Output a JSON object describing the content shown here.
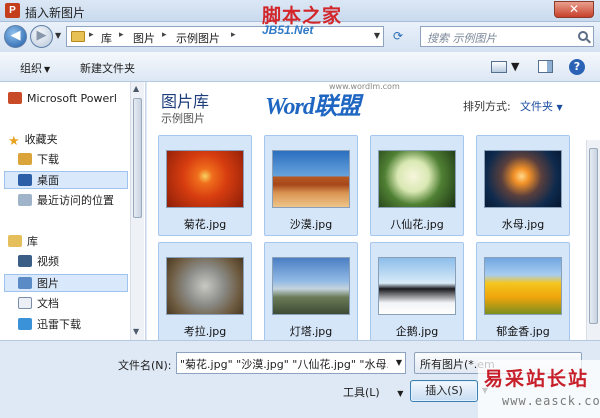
{
  "window": {
    "app_icon_letter": "P",
    "title": "插入新图片",
    "close_glyph": "✕"
  },
  "address": {
    "crumbs": [
      "库",
      "图片",
      "示例图片"
    ],
    "search_placeholder": "搜索 示例图片"
  },
  "toolbar": {
    "organize": "组织",
    "new_folder": "新建文件夹"
  },
  "nav": {
    "items": [
      {
        "label": "Microsoft Powerl",
        "icon": "powerpoint-icon"
      },
      {
        "label": "收藏夹",
        "icon": "star-icon"
      },
      {
        "label": "下载",
        "icon": "download-folder-icon"
      },
      {
        "label": "桌面",
        "icon": "desktop-icon",
        "selected": true
      },
      {
        "label": "最近访问的位置",
        "icon": "recent-places-icon"
      },
      {
        "label": "库",
        "icon": "library-icon"
      },
      {
        "label": "视频",
        "icon": "video-icon"
      },
      {
        "label": "图片",
        "icon": "pictures-icon",
        "selected": true
      },
      {
        "label": "文档",
        "icon": "documents-icon"
      },
      {
        "label": "迅雷下载",
        "icon": "xunlei-icon"
      }
    ]
  },
  "content": {
    "library_title": "图片库",
    "library_subtitle": "示例图片",
    "arrange_label": "排列方式:",
    "arrange_value": "文件夹",
    "files": [
      {
        "name": "菊花.jpg",
        "thumb": "chrysanthemum"
      },
      {
        "name": "沙漠.jpg",
        "thumb": "desert"
      },
      {
        "name": "八仙花.jpg",
        "thumb": "hydrangeas"
      },
      {
        "name": "水母.jpg",
        "thumb": "jellyfish"
      },
      {
        "name": "考拉.jpg",
        "thumb": "koala"
      },
      {
        "name": "灯塔.jpg",
        "thumb": "lighthouse"
      },
      {
        "name": "企鹅.jpg",
        "thumb": "penguins"
      },
      {
        "name": "郁金香.jpg",
        "thumb": "tulips"
      }
    ]
  },
  "bottom": {
    "filename_label": "文件名(N):",
    "filename_value": "\"菊花.jpg\" \"沙漠.jpg\" \"八仙花.jpg\" \"水母.jpg\"",
    "filter_value": "所有图片(*.em",
    "tools_label": "工具(L)",
    "insert_label": "插入(S)"
  },
  "watermarks": {
    "top_logo": "脚本之家",
    "top_sub": "JB51.Net",
    "word_logo": "Word联盟",
    "word_url": "www.wordlm.com",
    "bottom_logo": "易采站长站",
    "bottom_url": "www.easck.com"
  },
  "colors": {
    "selection_bg": "#d6e6f9",
    "selection_border": "#a5c7ee",
    "library_title": "#1e3e7b"
  }
}
